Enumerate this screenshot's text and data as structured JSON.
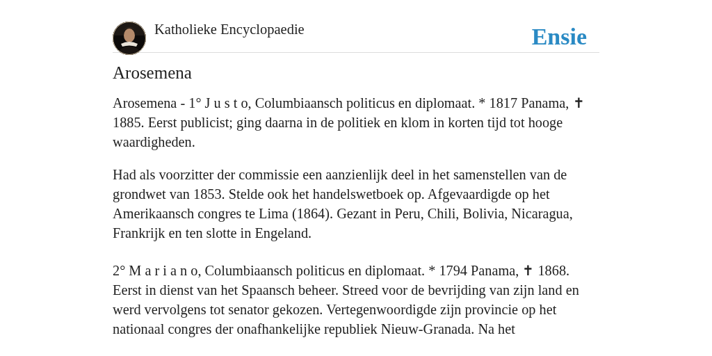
{
  "header": {
    "site_name": "Katholieke Encyclopaedie",
    "logo": "Ensie"
  },
  "article": {
    "title": "Arosemena",
    "paragraphs": [
      "Arosemena - 1° J u s t o, Columbiaansch politicus en diplomaat. * 1817 Panama, ✝ 1885. Eerst publicist; ging daarna in de politiek en klom in korten tijd tot hooge waardigheden.",
      "Had als voorzitter der commissie een aanzienlijk deel in het samenstellen van de grondwet van 1853. Stelde ook het handelswetboek op. Afgevaardigde op het Amerikaansch congres te Lima (1864). Gezant in Peru, Chili, Bolivia, Nicaragua, Frankrijk en ten slotte in Engeland.",
      "2° M a r i a n o, Columbiaansch politicus en diplomaat. * 1794 Panama, ✝ 1868. Eerst in dienst van het Spaansch beheer. Streed voor de bevrijding van zijn land en werd vervolgens tot senator gekozen. Vertegenwoordigde zijn provincie op het nationaal congres der onafhankelijke republiek Nieuw-Granada. Na het"
    ]
  }
}
